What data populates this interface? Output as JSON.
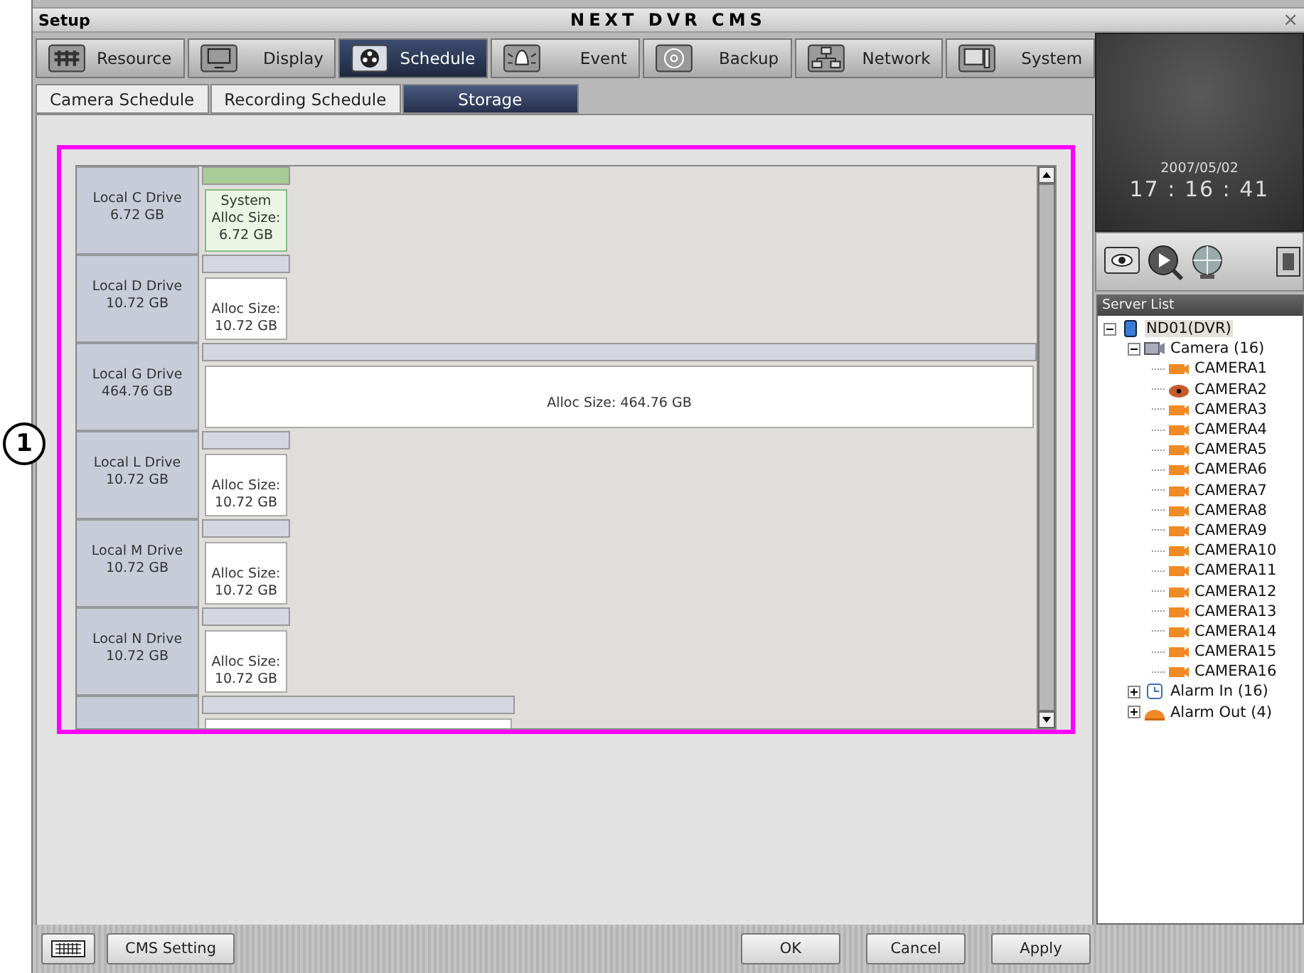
{
  "window": {
    "section": "Setup",
    "title": "NEXT DVR CMS",
    "close": "×"
  },
  "callout": {
    "number": "1"
  },
  "tabs": [
    {
      "label": "Resource",
      "selected": false
    },
    {
      "label": "Display",
      "selected": false
    },
    {
      "label": "Schedule",
      "selected": true
    },
    {
      "label": "Event",
      "selected": false
    },
    {
      "label": "Backup",
      "selected": false
    },
    {
      "label": "Network",
      "selected": false
    },
    {
      "label": "System",
      "selected": false
    }
  ],
  "subtabs": [
    {
      "label": "Camera Schedule",
      "selected": false
    },
    {
      "label": "Recording Schedule",
      "selected": false
    },
    {
      "label": "Storage",
      "selected": true
    }
  ],
  "drives": [
    {
      "name": "Local C Drive",
      "size": "6.72 GB",
      "partitions": [
        {
          "kind": "system",
          "lines": [
            "System",
            "Alloc Size:",
            "6.72 GB"
          ]
        }
      ]
    },
    {
      "name": "Local D Drive",
      "size": "10.72 GB",
      "partitions": [
        {
          "kind": "normal",
          "lines": [
            "Alloc Size:",
            "10.72 GB"
          ]
        }
      ]
    },
    {
      "name": "Local G Drive",
      "size": "464.76 GB",
      "partitions": [
        {
          "kind": "wide",
          "lines": [
            "Alloc Size: 464.76 GB"
          ]
        }
      ]
    },
    {
      "name": "Local L Drive",
      "size": "10.72 GB",
      "partitions": [
        {
          "kind": "normal",
          "lines": [
            "Alloc Size:",
            "10.72 GB"
          ]
        }
      ]
    },
    {
      "name": "Local M Drive",
      "size": "10.72 GB",
      "partitions": [
        {
          "kind": "normal",
          "lines": [
            "Alloc Size:",
            "10.72 GB"
          ]
        }
      ]
    },
    {
      "name": "Local N Drive",
      "size": "10.72 GB",
      "partitions": [
        {
          "kind": "normal",
          "lines": [
            "Alloc Size:",
            "10.72 GB"
          ]
        }
      ]
    },
    {
      "partitions": [
        {
          "kind": "medium"
        }
      ]
    }
  ],
  "clock": {
    "date": "2007/05/02",
    "time": "17 : 16 : 41"
  },
  "server_list": {
    "title": "Server List",
    "tree": [
      {
        "label": "ND01(DVR)",
        "kind": "server",
        "expanded": true,
        "selected": true,
        "children": [
          {
            "label": "Camera (16)",
            "kind": "camera-group",
            "expanded": true,
            "selected": false,
            "children": [
              {
                "label": "CAMERA1",
                "kind": "box-camera",
                "selected": false
              },
              {
                "label": "CAMERA2",
                "kind": "dome-camera",
                "selected": false
              },
              {
                "label": "CAMERA3",
                "kind": "box-camera",
                "selected": false
              },
              {
                "label": "CAMERA4",
                "kind": "box-camera",
                "selected": false
              },
              {
                "label": "CAMERA5",
                "kind": "box-camera",
                "selected": false
              },
              {
                "label": "CAMERA6",
                "kind": "box-camera",
                "selected": false
              },
              {
                "label": "CAMERA7",
                "kind": "box-camera",
                "selected": false
              },
              {
                "label": "CAMERA8",
                "kind": "box-camera",
                "selected": false
              },
              {
                "label": "CAMERA9",
                "kind": "box-camera",
                "selected": false
              },
              {
                "label": "CAMERA10",
                "kind": "box-camera",
                "selected": false
              },
              {
                "label": "CAMERA11",
                "kind": "box-camera",
                "selected": false
              },
              {
                "label": "CAMERA12",
                "kind": "box-camera",
                "selected": false
              },
              {
                "label": "CAMERA13",
                "kind": "box-camera",
                "selected": false
              },
              {
                "label": "CAMERA14",
                "kind": "box-camera",
                "selected": false
              },
              {
                "label": "CAMERA15",
                "kind": "box-camera",
                "selected": false
              },
              {
                "label": "CAMERA16",
                "kind": "box-camera",
                "selected": false
              }
            ]
          },
          {
            "label": "Alarm In (16)",
            "kind": "alarm-in",
            "expanded": false,
            "selected": false
          },
          {
            "label": "Alarm Out (4)",
            "kind": "alarm-out",
            "expanded": false,
            "selected": false
          }
        ]
      }
    ]
  },
  "footer": {
    "settings_button": "CMS Setting",
    "buttons": [
      "OK",
      "Cancel",
      "Apply"
    ]
  }
}
